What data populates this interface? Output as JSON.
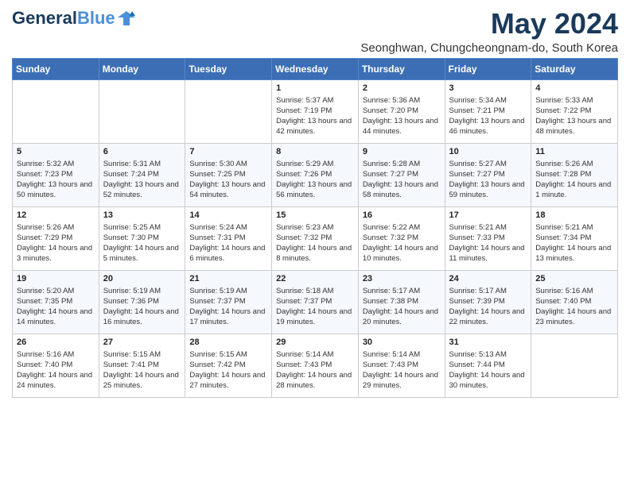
{
  "header": {
    "logo_general": "General",
    "logo_blue": "Blue",
    "main_title": "May 2024",
    "subtitle": "Seonghwan, Chungcheongnam-do, South Korea"
  },
  "days_of_week": [
    "Sunday",
    "Monday",
    "Tuesday",
    "Wednesday",
    "Thursday",
    "Friday",
    "Saturday"
  ],
  "weeks": [
    [
      {
        "day": null
      },
      {
        "day": null
      },
      {
        "day": null
      },
      {
        "day": "1",
        "sunrise": "5:37 AM",
        "sunset": "7:19 PM",
        "daylight": "13 hours and 42 minutes."
      },
      {
        "day": "2",
        "sunrise": "5:36 AM",
        "sunset": "7:20 PM",
        "daylight": "13 hours and 44 minutes."
      },
      {
        "day": "3",
        "sunrise": "5:34 AM",
        "sunset": "7:21 PM",
        "daylight": "13 hours and 46 minutes."
      },
      {
        "day": "4",
        "sunrise": "5:33 AM",
        "sunset": "7:22 PM",
        "daylight": "13 hours and 48 minutes."
      }
    ],
    [
      {
        "day": "5",
        "sunrise": "5:32 AM",
        "sunset": "7:23 PM",
        "daylight": "13 hours and 50 minutes."
      },
      {
        "day": "6",
        "sunrise": "5:31 AM",
        "sunset": "7:24 PM",
        "daylight": "13 hours and 52 minutes."
      },
      {
        "day": "7",
        "sunrise": "5:30 AM",
        "sunset": "7:25 PM",
        "daylight": "13 hours and 54 minutes."
      },
      {
        "day": "8",
        "sunrise": "5:29 AM",
        "sunset": "7:26 PM",
        "daylight": "13 hours and 56 minutes."
      },
      {
        "day": "9",
        "sunrise": "5:28 AM",
        "sunset": "7:27 PM",
        "daylight": "13 hours and 58 minutes."
      },
      {
        "day": "10",
        "sunrise": "5:27 AM",
        "sunset": "7:27 PM",
        "daylight": "13 hours and 59 minutes."
      },
      {
        "day": "11",
        "sunrise": "5:26 AM",
        "sunset": "7:28 PM",
        "daylight": "14 hours and 1 minute."
      }
    ],
    [
      {
        "day": "12",
        "sunrise": "5:26 AM",
        "sunset": "7:29 PM",
        "daylight": "14 hours and 3 minutes."
      },
      {
        "day": "13",
        "sunrise": "5:25 AM",
        "sunset": "7:30 PM",
        "daylight": "14 hours and 5 minutes."
      },
      {
        "day": "14",
        "sunrise": "5:24 AM",
        "sunset": "7:31 PM",
        "daylight": "14 hours and 6 minutes."
      },
      {
        "day": "15",
        "sunrise": "5:23 AM",
        "sunset": "7:32 PM",
        "daylight": "14 hours and 8 minutes."
      },
      {
        "day": "16",
        "sunrise": "5:22 AM",
        "sunset": "7:32 PM",
        "daylight": "14 hours and 10 minutes."
      },
      {
        "day": "17",
        "sunrise": "5:21 AM",
        "sunset": "7:33 PM",
        "daylight": "14 hours and 11 minutes."
      },
      {
        "day": "18",
        "sunrise": "5:21 AM",
        "sunset": "7:34 PM",
        "daylight": "14 hours and 13 minutes."
      }
    ],
    [
      {
        "day": "19",
        "sunrise": "5:20 AM",
        "sunset": "7:35 PM",
        "daylight": "14 hours and 14 minutes."
      },
      {
        "day": "20",
        "sunrise": "5:19 AM",
        "sunset": "7:36 PM",
        "daylight": "14 hours and 16 minutes."
      },
      {
        "day": "21",
        "sunrise": "5:19 AM",
        "sunset": "7:37 PM",
        "daylight": "14 hours and 17 minutes."
      },
      {
        "day": "22",
        "sunrise": "5:18 AM",
        "sunset": "7:37 PM",
        "daylight": "14 hours and 19 minutes."
      },
      {
        "day": "23",
        "sunrise": "5:17 AM",
        "sunset": "7:38 PM",
        "daylight": "14 hours and 20 minutes."
      },
      {
        "day": "24",
        "sunrise": "5:17 AM",
        "sunset": "7:39 PM",
        "daylight": "14 hours and 22 minutes."
      },
      {
        "day": "25",
        "sunrise": "5:16 AM",
        "sunset": "7:40 PM",
        "daylight": "14 hours and 23 minutes."
      }
    ],
    [
      {
        "day": "26",
        "sunrise": "5:16 AM",
        "sunset": "7:40 PM",
        "daylight": "14 hours and 24 minutes."
      },
      {
        "day": "27",
        "sunrise": "5:15 AM",
        "sunset": "7:41 PM",
        "daylight": "14 hours and 25 minutes."
      },
      {
        "day": "28",
        "sunrise": "5:15 AM",
        "sunset": "7:42 PM",
        "daylight": "14 hours and 27 minutes."
      },
      {
        "day": "29",
        "sunrise": "5:14 AM",
        "sunset": "7:43 PM",
        "daylight": "14 hours and 28 minutes."
      },
      {
        "day": "30",
        "sunrise": "5:14 AM",
        "sunset": "7:43 PM",
        "daylight": "14 hours and 29 minutes."
      },
      {
        "day": "31",
        "sunrise": "5:13 AM",
        "sunset": "7:44 PM",
        "daylight": "14 hours and 30 minutes."
      },
      {
        "day": null
      }
    ]
  ]
}
